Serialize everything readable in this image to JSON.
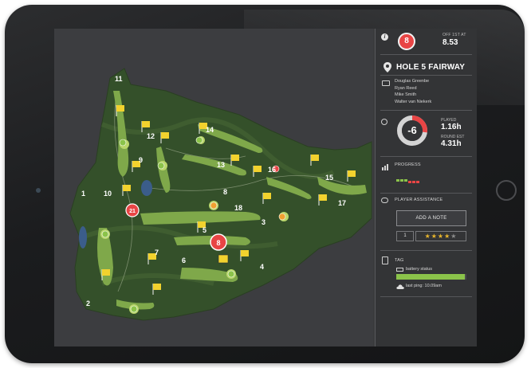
{
  "header": {
    "group_number": "8",
    "off_first_label": "OFF 1ST AT",
    "off_first_time": "8.53",
    "icons": {
      "info": "info-icon"
    }
  },
  "location": {
    "text": "HOLE 5 FAIRWAY",
    "icon": "location-pin-icon"
  },
  "players": [
    "Douglas Greenbe",
    "Ryan Reed",
    "Mike Smith",
    "Walter van Niekerk"
  ],
  "pace": {
    "score": "-6",
    "played_label": "PLAYED",
    "played_value": "1.16h",
    "round_est_label": "ROUND EST",
    "round_est_value": "4.31h",
    "ring_fraction": 0.27,
    "icon": "stopwatch-icon"
  },
  "progress": {
    "label": "PROGRESS",
    "icon": "bar-chart-icon",
    "segments": [
      "#8bc34a",
      "#8bc34a",
      "#8bc34a",
      "#e84545",
      "#e84545",
      "#e84545"
    ]
  },
  "assistance": {
    "label": "PLAYER ASSISTANCE",
    "icon": "chat-bubble-icon",
    "add_note_label": "ADD A NOTE",
    "rating_number": "1",
    "rating": 4,
    "rating_max": 5
  },
  "tag": {
    "label": "TAG",
    "icon": "tag-device-icon",
    "battery_label": "battery status",
    "battery_level": 0.98,
    "ping_label": "last ping: 10.09am",
    "ping_icon": "cloud-upload-icon"
  },
  "map": {
    "hole_numbers": [
      "1",
      "2",
      "3",
      "4",
      "5",
      "6",
      "7",
      "8",
      "9",
      "10",
      "11",
      "12",
      "13",
      "14",
      "15",
      "16",
      "17",
      "18"
    ],
    "group_markers": [
      "8",
      "21",
      "17"
    ],
    "colors": {
      "fairway": "#7fa84a",
      "green": "#b9d66a",
      "rough": "#3d5a2a",
      "flag": "#f2d22e",
      "marker": "#e84545"
    }
  }
}
